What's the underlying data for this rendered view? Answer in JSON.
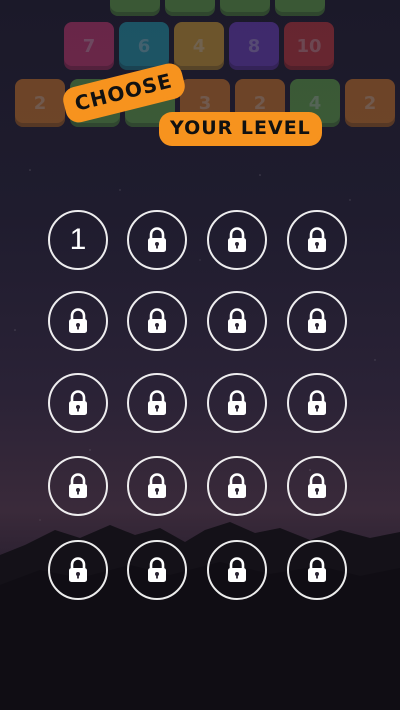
{
  "title": {
    "line1": "CHOOSE",
    "line2": "YOUR LEVEL"
  },
  "colors": {
    "accent": "#f7931e",
    "tile_green": "#6cc04a",
    "tile_pink": "#e63d7a",
    "tile_cyan": "#1fb3c4",
    "tile_yellow": "#f2b630",
    "tile_purple": "#7a44d8",
    "tile_red": "#e03a3a",
    "tile_orange": "#f08a24"
  },
  "background_tiles": [
    {
      "row": 0,
      "label": "",
      "color": "tile_green"
    },
    {
      "row": 0,
      "label": "",
      "color": "tile_green"
    },
    {
      "row": 0,
      "label": "",
      "color": "tile_green"
    },
    {
      "row": 0,
      "label": "",
      "color": "tile_green"
    },
    {
      "row": 1,
      "label": "7",
      "color": "tile_pink"
    },
    {
      "row": 1,
      "label": "6",
      "color": "tile_cyan"
    },
    {
      "row": 1,
      "label": "4",
      "color": "tile_yellow"
    },
    {
      "row": 1,
      "label": "8",
      "color": "tile_purple"
    },
    {
      "row": 1,
      "label": "10",
      "color": "tile_red"
    },
    {
      "row": 2,
      "label": "2",
      "color": "tile_orange"
    },
    {
      "row": 2,
      "label": "",
      "color": "tile_green"
    },
    {
      "row": 2,
      "label": "",
      "color": "tile_green"
    },
    {
      "row": 2,
      "label": "3",
      "color": "tile_orange"
    },
    {
      "row": 2,
      "label": "2",
      "color": "tile_orange"
    },
    {
      "row": 2,
      "label": "4",
      "color": "tile_green"
    },
    {
      "row": 2,
      "label": "2",
      "color": "tile_orange"
    }
  ],
  "levels": [
    {
      "label": "1",
      "locked": false
    },
    {
      "label": "",
      "locked": true
    },
    {
      "label": "",
      "locked": true
    },
    {
      "label": "",
      "locked": true
    },
    {
      "label": "",
      "locked": true
    },
    {
      "label": "",
      "locked": true
    },
    {
      "label": "",
      "locked": true
    },
    {
      "label": "",
      "locked": true
    },
    {
      "label": "",
      "locked": true
    },
    {
      "label": "",
      "locked": true
    },
    {
      "label": "",
      "locked": true
    },
    {
      "label": "",
      "locked": true
    },
    {
      "label": "",
      "locked": true
    },
    {
      "label": "",
      "locked": true
    },
    {
      "label": "",
      "locked": true
    },
    {
      "label": "",
      "locked": true
    },
    {
      "label": "",
      "locked": true
    },
    {
      "label": "",
      "locked": true
    },
    {
      "label": "",
      "locked": true
    },
    {
      "label": "",
      "locked": true
    }
  ],
  "icons": {
    "locked": "lock-icon"
  }
}
